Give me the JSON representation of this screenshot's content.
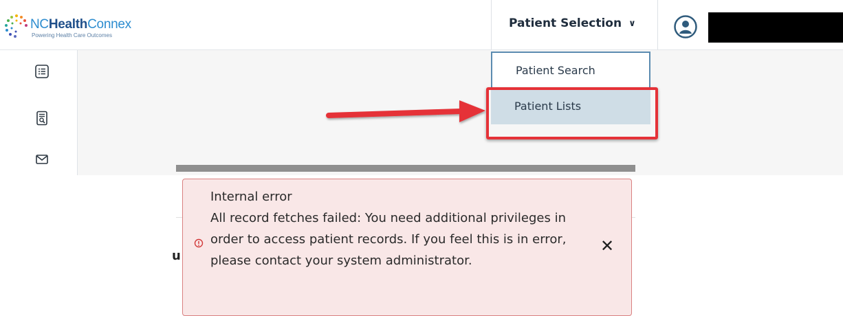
{
  "header": {
    "logo": {
      "nc": "NC",
      "health": "Health",
      "connex": "Connex",
      "tagline": "Powering Health Care Outcomes"
    },
    "patient_selection_label": "Patient Selection",
    "chevron": "chevron-down-icon",
    "user_avatar_icon": "user-avatar-icon"
  },
  "sidebar": {
    "items": [
      {
        "icon": "list-icon"
      },
      {
        "icon": "document-search-icon"
      },
      {
        "icon": "mail-icon"
      }
    ]
  },
  "dropdown": {
    "items": [
      {
        "label": "Patient Search"
      },
      {
        "label": "Patient Lists"
      }
    ]
  },
  "annotation": {
    "arrow_color": "#e53238",
    "highlight_color": "#e53238"
  },
  "toast": {
    "title": "Internal error",
    "message": "All record fetches failed: You need additional privileges in order to access patient records. If you feel this is in error, please contact your system administrator.",
    "close_glyph": "✕",
    "background_fragment": "u"
  },
  "colors": {
    "accent": "#2c8ccf",
    "error_bg": "#f9e7e7",
    "error_border": "#d98080",
    "selected_item": "#cfdde6"
  }
}
